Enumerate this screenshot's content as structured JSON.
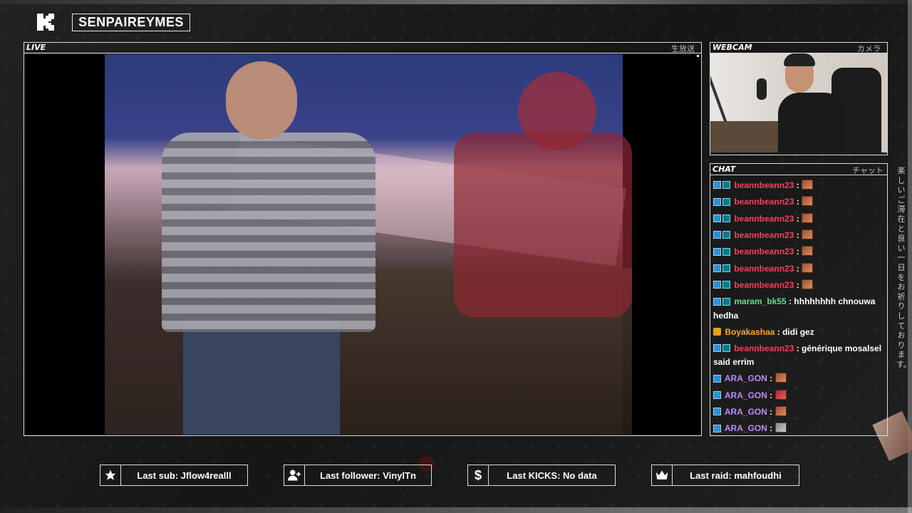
{
  "channel": {
    "name": "SENPAIREYMES",
    "logo_icon": "kick-k-logo"
  },
  "live_panel": {
    "label": "LIVE",
    "jp": "生放送"
  },
  "webcam_panel": {
    "label": "WEBCAM",
    "jp": "カメラ"
  },
  "chat_panel": {
    "label": "CHAT",
    "jp": "チャット",
    "messages": [
      {
        "user": "beannbeann23",
        "sep": " :",
        "text": "",
        "emote": "emote-1"
      },
      {
        "user": "beannbeann23",
        "sep": " :",
        "text": "",
        "emote": "emote-1"
      },
      {
        "user": "beannbeann23",
        "sep": " :",
        "text": "",
        "emote": "emote-1"
      },
      {
        "user": "beannbeann23",
        "sep": " :",
        "text": "",
        "emote": "emote-1"
      },
      {
        "user": "beannbeann23",
        "sep": " :",
        "text": "",
        "emote": "emote-1"
      },
      {
        "user": "beannbeann23",
        "sep": " :",
        "text": "",
        "emote": "emote-1"
      },
      {
        "user": "beannbeann23",
        "sep": " :",
        "text": "",
        "emote": "emote-1"
      },
      {
        "user": "maram_bk55",
        "sep": " :",
        "text": " hhhhhhhh chnouwa hedha"
      },
      {
        "user": "Boyakashaa",
        "sep": " :",
        "text": " didi gez"
      },
      {
        "user": "beannbeann23",
        "sep": " :",
        "text": " générique mosalsel said errim"
      },
      {
        "user": "ARA_GON",
        "sep": " :",
        "text": "",
        "emote": "emote-2"
      },
      {
        "user": "ARA_GON",
        "sep": " :",
        "text": "",
        "emote": "emote-3"
      },
      {
        "user": "ARA_GON",
        "sep": " :",
        "text": "",
        "emote": "emote-4"
      },
      {
        "user": "ARA_GON",
        "sep": " :",
        "text": "",
        "emote": "emote-5"
      }
    ]
  },
  "side_text": "楽しいご滞在と良い一日をお祈りしております。",
  "stats": {
    "last_sub": {
      "icon": "star-icon",
      "text": "Last sub: Jflow4realll"
    },
    "last_follower": {
      "icon": "add-user-icon",
      "text": "Last follower: VinylTn"
    },
    "last_kicks": {
      "icon": "dollar-icon",
      "text": "Last KICKS: No data"
    },
    "last_raid": {
      "icon": "crown-icon",
      "text": "Last raid: mahfoudhi"
    }
  },
  "colors": {
    "background": "#1b1b1b",
    "username_red": "#ff3b5c",
    "username_green": "#5fe089",
    "username_orange": "#f5a623",
    "username_purple": "#b98cff"
  }
}
